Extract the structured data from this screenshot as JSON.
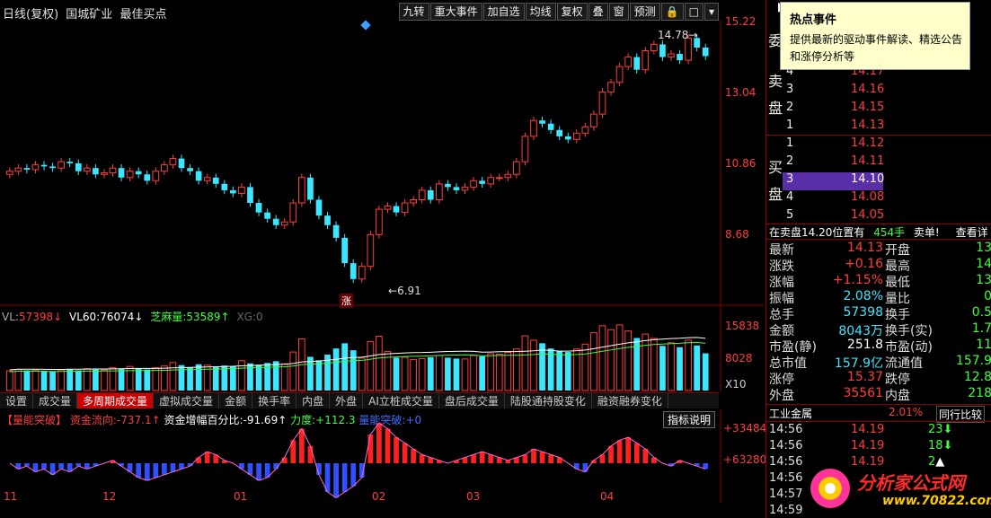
{
  "header": {
    "period": "日线(复权)",
    "stock_name": "国城矿业",
    "indicator": "最佳买点"
  },
  "toolbar": [
    "九转",
    "重大事件",
    "加自选",
    "均线",
    "复权",
    "叠",
    "窗",
    "预测"
  ],
  "toolbar_icons": [
    "lock-icon",
    "square-icon",
    "dropdown-icon"
  ],
  "price_axis": [
    "15.22",
    "13.04",
    "10.86",
    "8.68"
  ],
  "annotations": {
    "high": "14.78",
    "low": "6.91",
    "zhang_mark": "涨"
  },
  "volume": {
    "vl_label": "VL:",
    "vl_value": "57398",
    "vl60_label": "VL60:",
    "vl60_value": "76074",
    "zhima_label": "芝麻量:",
    "zhima_value": "53589",
    "xg_label": "XG:",
    "xg_value": "0",
    "axis": [
      "15838",
      "8028",
      "X10"
    ]
  },
  "tabs": [
    "设置",
    "成交量",
    "多周期成交量",
    "虚拟成交量",
    "金额",
    "换手率",
    "内盘",
    "外盘",
    "AI立桩成交量",
    "盘后成交量",
    "陆股通持股变化",
    "融资融券变化"
  ],
  "active_tab": "多周期成交量",
  "indicator_panel": {
    "name": "【量能突破】",
    "flow_label": "资金流向:",
    "flow_value": "-737.1",
    "pct_label": "资金增幅百分比:",
    "pct_value": "-91.69",
    "force_label": "力度:",
    "force_value": "+112.3",
    "break_label": "量能突破:",
    "break_value": "+0",
    "help_button": "指标说明",
    "axis": [
      "+334846",
      "+63280"
    ]
  },
  "x_axis": [
    "11",
    "12",
    "01",
    "02",
    "03",
    "04"
  ],
  "tooltip": {
    "title": "热点事件",
    "text": "提供最新的驱动事件解读、精选公告和涨停分析等"
  },
  "order_book": {
    "wei_label": "委",
    "sell_label_1": "卖",
    "sell_label_2": "盘",
    "buy_label_1": "买",
    "buy_label_2": "盘",
    "sell": [
      {
        "level": "4",
        "price": "14.17"
      },
      {
        "level": "3",
        "price": "14.16"
      },
      {
        "level": "2",
        "price": "14.15"
      },
      {
        "level": "1",
        "price": "14.13"
      }
    ],
    "buy": [
      {
        "level": "1",
        "price": "14.12"
      },
      {
        "level": "2",
        "price": "14.11"
      },
      {
        "level": "3",
        "price": "14.10"
      },
      {
        "level": "4",
        "price": "14.08"
      },
      {
        "level": "5",
        "price": "14.05"
      }
    ],
    "highlighted_buy_level": "3"
  },
  "sell_status": {
    "text": "在卖盘14.20位置有",
    "qty": "454手",
    "action": "卖单!",
    "more": "查看详"
  },
  "stats": [
    {
      "l1": "最新",
      "v1": "14.13",
      "c1": "red",
      "l2": "开盘",
      "v2": "13"
    },
    {
      "l1": "涨跌",
      "v1": "+0.16",
      "c1": "red",
      "l2": "最高",
      "v2": "14"
    },
    {
      "l1": "涨幅",
      "v1": "+1.15%",
      "c1": "red",
      "l2": "最低",
      "v2": "13"
    },
    {
      "l1": "振幅",
      "v1": "2.08%",
      "c1": "cyan",
      "l2": "量比",
      "v2": "0"
    },
    {
      "l1": "总手",
      "v1": "57398",
      "c1": "cyan",
      "l2": "换手",
      "v2": "0.5"
    },
    {
      "l1": "金额",
      "v1": "8043万",
      "c1": "cyan",
      "l2": "换手(实)",
      "v2": "1.7"
    },
    {
      "l1": "市盈(静)",
      "v1": "251.8",
      "c1": "white",
      "l2": "市盈(动)",
      "v2": "11"
    },
    {
      "l1": "总市值",
      "v1": "157.9亿",
      "c1": "cyan",
      "l2": "流通值",
      "v2": "157.9"
    },
    {
      "l1": "涨停",
      "v1": "15.37",
      "c1": "red",
      "l2": "跌停",
      "v2": "12.8"
    },
    {
      "l1": "外盘",
      "v1": "35561",
      "c1": "red",
      "l2": "内盘",
      "v2": "218"
    }
  ],
  "industry": {
    "name": "工业金属",
    "pct": "2.01%",
    "compare": "同行比较"
  },
  "ticks": [
    {
      "time": "14:56",
      "price": "14.19",
      "vol": "23"
    },
    {
      "time": "14:56",
      "price": "14.19",
      "vol": "18"
    },
    {
      "time": "14:56",
      "price": "14.19",
      "vol": "2"
    },
    {
      "time": "14:56",
      "price": "",
      "vol": ""
    },
    {
      "time": "14:57",
      "price": "",
      "vol": ""
    },
    {
      "time": "14:59",
      "price": "",
      "vol": ""
    }
  ],
  "watermark": {
    "title": "分析家公式网",
    "url": "www.70822.com"
  },
  "colors": {
    "up": "#ff3c3c",
    "down": "#3ce6ff",
    "highlight": "#5a2ea8",
    "border": "#880000"
  },
  "chart_data": {
    "type": "candlestick",
    "ylim": [
      6.5,
      15.22
    ],
    "closes": [
      10.5,
      10.6,
      10.55,
      10.7,
      10.65,
      10.6,
      10.8,
      10.75,
      10.5,
      10.6,
      10.4,
      10.45,
      10.6,
      10.3,
      10.5,
      10.4,
      10.2,
      10.5,
      10.7,
      10.9,
      10.6,
      10.5,
      10.2,
      10.3,
      10.1,
      9.9,
      9.8,
      10.0,
      9.5,
      9.2,
      9.0,
      8.8,
      8.9,
      9.5,
      10.3,
      9.6,
      9.1,
      8.8,
      8.4,
      7.6,
      7.1,
      7.5,
      8.5,
      9.3,
      9.4,
      9.2,
      9.5,
      9.6,
      9.9,
      9.6,
      10.1,
      10.0,
      9.9,
      10.0,
      10.2,
      10.1,
      10.3,
      10.3,
      10.4,
      10.8,
      11.6,
      12.1,
      12.0,
      11.8,
      11.6,
      11.5,
      11.7,
      11.9,
      12.3,
      13.0,
      13.3,
      13.8,
      14.1,
      13.7,
      14.3,
      14.5,
      14.1,
      14.2,
      14.0,
      14.7,
      14.4,
      14.13
    ],
    "opens": [
      10.4,
      10.5,
      10.6,
      10.55,
      10.7,
      10.65,
      10.6,
      10.8,
      10.75,
      10.5,
      10.6,
      10.4,
      10.45,
      10.6,
      10.3,
      10.5,
      10.4,
      10.2,
      10.5,
      10.7,
      10.9,
      10.6,
      10.5,
      10.2,
      10.3,
      10.1,
      9.9,
      9.8,
      10.0,
      9.5,
      9.2,
      9.0,
      8.8,
      8.9,
      9.5,
      10.3,
      9.6,
      9.1,
      8.8,
      8.4,
      7.6,
      7.1,
      7.5,
      8.5,
      9.3,
      9.4,
      9.2,
      9.5,
      9.6,
      9.9,
      9.6,
      10.1,
      10.0,
      9.9,
      10.0,
      10.2,
      10.1,
      10.3,
      10.3,
      10.4,
      10.8,
      11.6,
      12.1,
      12.0,
      11.8,
      11.6,
      11.5,
      11.7,
      11.9,
      12.3,
      13.0,
      13.3,
      13.8,
      14.1,
      13.7,
      14.3,
      14.5,
      14.1,
      14.2,
      14.0,
      14.7,
      14.4
    ],
    "volumes": [
      4500,
      4800,
      4600,
      4700,
      4500,
      4400,
      4700,
      4900,
      4600,
      5000,
      4800,
      4700,
      5200,
      4900,
      5500,
      5000,
      4800,
      5200,
      5600,
      6400,
      5800,
      5300,
      6000,
      5800,
      5400,
      5700,
      5600,
      6800,
      6200,
      5900,
      6300,
      6700,
      6100,
      8800,
      11800,
      7700,
      6900,
      8200,
      9600,
      10800,
      9200,
      7400,
      11200,
      12400,
      8900,
      7500,
      7600,
      7100,
      7300,
      7600,
      8000,
      7500,
      7300,
      7200,
      8000,
      7800,
      8400,
      8300,
      8700,
      9500,
      12500,
      11500,
      10800,
      9600,
      9000,
      8800,
      9500,
      10600,
      13200,
      14800,
      13900,
      15000,
      13600,
      12000,
      12900,
      11900,
      10200,
      10900,
      9900,
      11500,
      10300,
      8500
    ],
    "flow": [
      0,
      -2,
      -1,
      -3,
      -2,
      -4,
      -2,
      -3,
      -1,
      -2,
      -1,
      0,
      1,
      -1,
      -3,
      -5,
      -6,
      -5,
      -4,
      -3,
      -2,
      -1,
      2,
      4,
      3,
      1,
      0,
      -2,
      -4,
      -6,
      -5,
      -2,
      2,
      8,
      12,
      6,
      -4,
      -10,
      -12,
      -10,
      -8,
      -5,
      10,
      14,
      12,
      9,
      7,
      5,
      3,
      2,
      1,
      0,
      1,
      2,
      3,
      4,
      3,
      2,
      1,
      2,
      3,
      5,
      4,
      3,
      2,
      0,
      -2,
      -3,
      1,
      3,
      6,
      8,
      9,
      7,
      5,
      2,
      0,
      -1,
      1,
      0,
      -1,
      -2
    ]
  }
}
